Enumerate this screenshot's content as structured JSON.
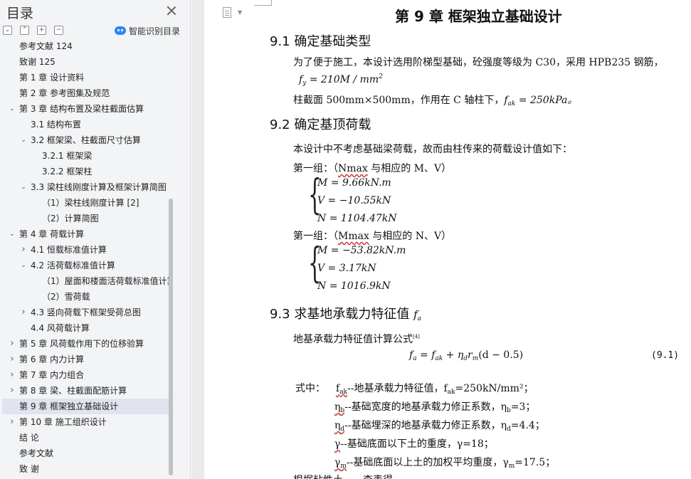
{
  "toc": {
    "title": "目录",
    "smart_label": "智能识别目录",
    "toolbar_icons": [
      "collapse-all-icon",
      "expand-icon",
      "add-icon",
      "remove-icon"
    ],
    "items": [
      {
        "label": "参考文献 124",
        "level": 1,
        "caret": ""
      },
      {
        "label": "致谢 125",
        "level": 1,
        "caret": ""
      },
      {
        "label": "第 1 章  设计资料",
        "level": 1,
        "caret": ""
      },
      {
        "label": "第 2 章  参考图集及规范",
        "level": 1,
        "caret": ""
      },
      {
        "label": "第 3 章    结构布置及梁柱截面估算",
        "level": 1,
        "caret": "down"
      },
      {
        "label": "3.1 结构布置",
        "level": 2,
        "caret": ""
      },
      {
        "label": "3.2 框架梁、柱截面尺寸估算",
        "level": 2,
        "caret": "down"
      },
      {
        "label": "3.2.1 框架梁",
        "level": 3,
        "caret": ""
      },
      {
        "label": "3.2.2 框架柱",
        "level": 3,
        "caret": ""
      },
      {
        "label": "3.3 梁柱线刚度计算及框架计算简图",
        "level": 2,
        "caret": "down"
      },
      {
        "label": "（1）梁柱线刚度计算 [2]",
        "level": 3,
        "caret": ""
      },
      {
        "label": "（2）计算简图",
        "level": 3,
        "caret": ""
      },
      {
        "label": "第 4 章  荷载计算",
        "level": 1,
        "caret": "down"
      },
      {
        "label": "4.1 恒载标准值计算",
        "level": 2,
        "caret": "right"
      },
      {
        "label": "4.2 活荷载标准值计算",
        "level": 2,
        "caret": "down"
      },
      {
        "label": "（1）屋面和楼面活荷载标准值计算",
        "level": 3,
        "caret": ""
      },
      {
        "label": "（2）雪荷载",
        "level": 3,
        "caret": ""
      },
      {
        "label": "4.3 竖向荷载下框架受荷总图",
        "level": 2,
        "caret": "right"
      },
      {
        "label": "4.4 风荷载计算",
        "level": 2,
        "caret": ""
      },
      {
        "label": "第 5 章  风荷载作用下的位移验算",
        "level": 1,
        "caret": "right"
      },
      {
        "label": "第 6 章    内力计算",
        "level": 1,
        "caret": "right"
      },
      {
        "label": "第 7 章  内力组合",
        "level": 1,
        "caret": "right"
      },
      {
        "label": "第 8 章    梁、柱截面配筋计算",
        "level": 1,
        "caret": "right"
      },
      {
        "label": "第 9 章  框架独立基础设计",
        "level": 1,
        "caret": "",
        "selected": true
      },
      {
        "label": "第 10 章    施工组织设计",
        "level": 1,
        "caret": "right"
      },
      {
        "label": "结    论",
        "level": 1,
        "caret": ""
      },
      {
        "label": "参考文献",
        "level": 1,
        "caret": ""
      },
      {
        "label": "致    谢",
        "level": 1,
        "caret": ""
      }
    ]
  },
  "doc": {
    "chapter_title": "第 9 章  框架独立基础设计",
    "s1_title": "9.1 确定基础类型",
    "s1_p1": "为了便于施工，本设计选用阶梯型基础，砼强度等级为 C30，采用 HPB235 钢筋，",
    "s1_fy": "f",
    "s1_fy_sub": "y",
    "s1_fy_rest": " = 210M / mm",
    "s1_fy_sup": "2",
    "s1_p2": "柱截面 500mm×500mm，作用在 C 轴柱下，",
    "s1_fak": "f",
    "s1_fak_sub": "ak",
    "s1_fak_rest": " = 250kPa。",
    "s2_title": "9.2 确定基顶荷载",
    "s2_p1": "本设计中不考虑基础梁荷载，故而由柱传来的荷载设计值如下：",
    "group1_prefix": "第一组：（",
    "group1_key": "Nmax",
    "group1_suffix": " 与相应的 M、V）",
    "group1": [
      "M = 9.66kN.m",
      "V = −10.55kN",
      "N = 1104.47kN"
    ],
    "group2_prefix": "第一组：（",
    "group2_key": "Mmax",
    "group2_suffix": " 与相应的 N、V）",
    "group2": [
      "M = −53.82kN.m",
      "V = 3.17kN",
      "N = 1016.9kN"
    ],
    "s3_title": "9.3 求基地承载力特征值",
    "s3_title_math": "f",
    "s3_title_sub": "a",
    "s3_p1": "地基承载力特征值计算公式",
    "s3_p1_ref": "[4]",
    "formula_lhs": "f",
    "formula_lhs_sub": "a",
    "formula_mid": " = f",
    "formula_mid_sub": "ak",
    "formula_rest": " + η",
    "formula_rest_sub": "d",
    "formula_r": "r",
    "formula_r_sub": "m",
    "formula_end": "(d − 0.5)",
    "formula_no": "(9.1)",
    "where_label": "式中：",
    "where_lines": [
      "f",
      "η",
      "η",
      "γ",
      "γ"
    ],
    "where_subs": [
      "ak",
      "b",
      "d",
      "",
      "m"
    ],
    "where_texts": [
      "--地基承载力特征值，f",
      "--基础宽度的地基承载力修正系数，η",
      "--基础埋深的地基承载力修正系数，η",
      "--基础底面以下土的重度，γ=18；",
      "--基础底面以上土的加权平均重度，γ"
    ],
    "where_tails": [
      "=250kN/mm²；",
      "=3；",
      "=4.4；",
      "",
      "=17.5；"
    ],
    "where_tail_subs": [
      "ak",
      "b",
      "d",
      "",
      "m"
    ],
    "last_line": "根据粘性土……查表得……"
  }
}
